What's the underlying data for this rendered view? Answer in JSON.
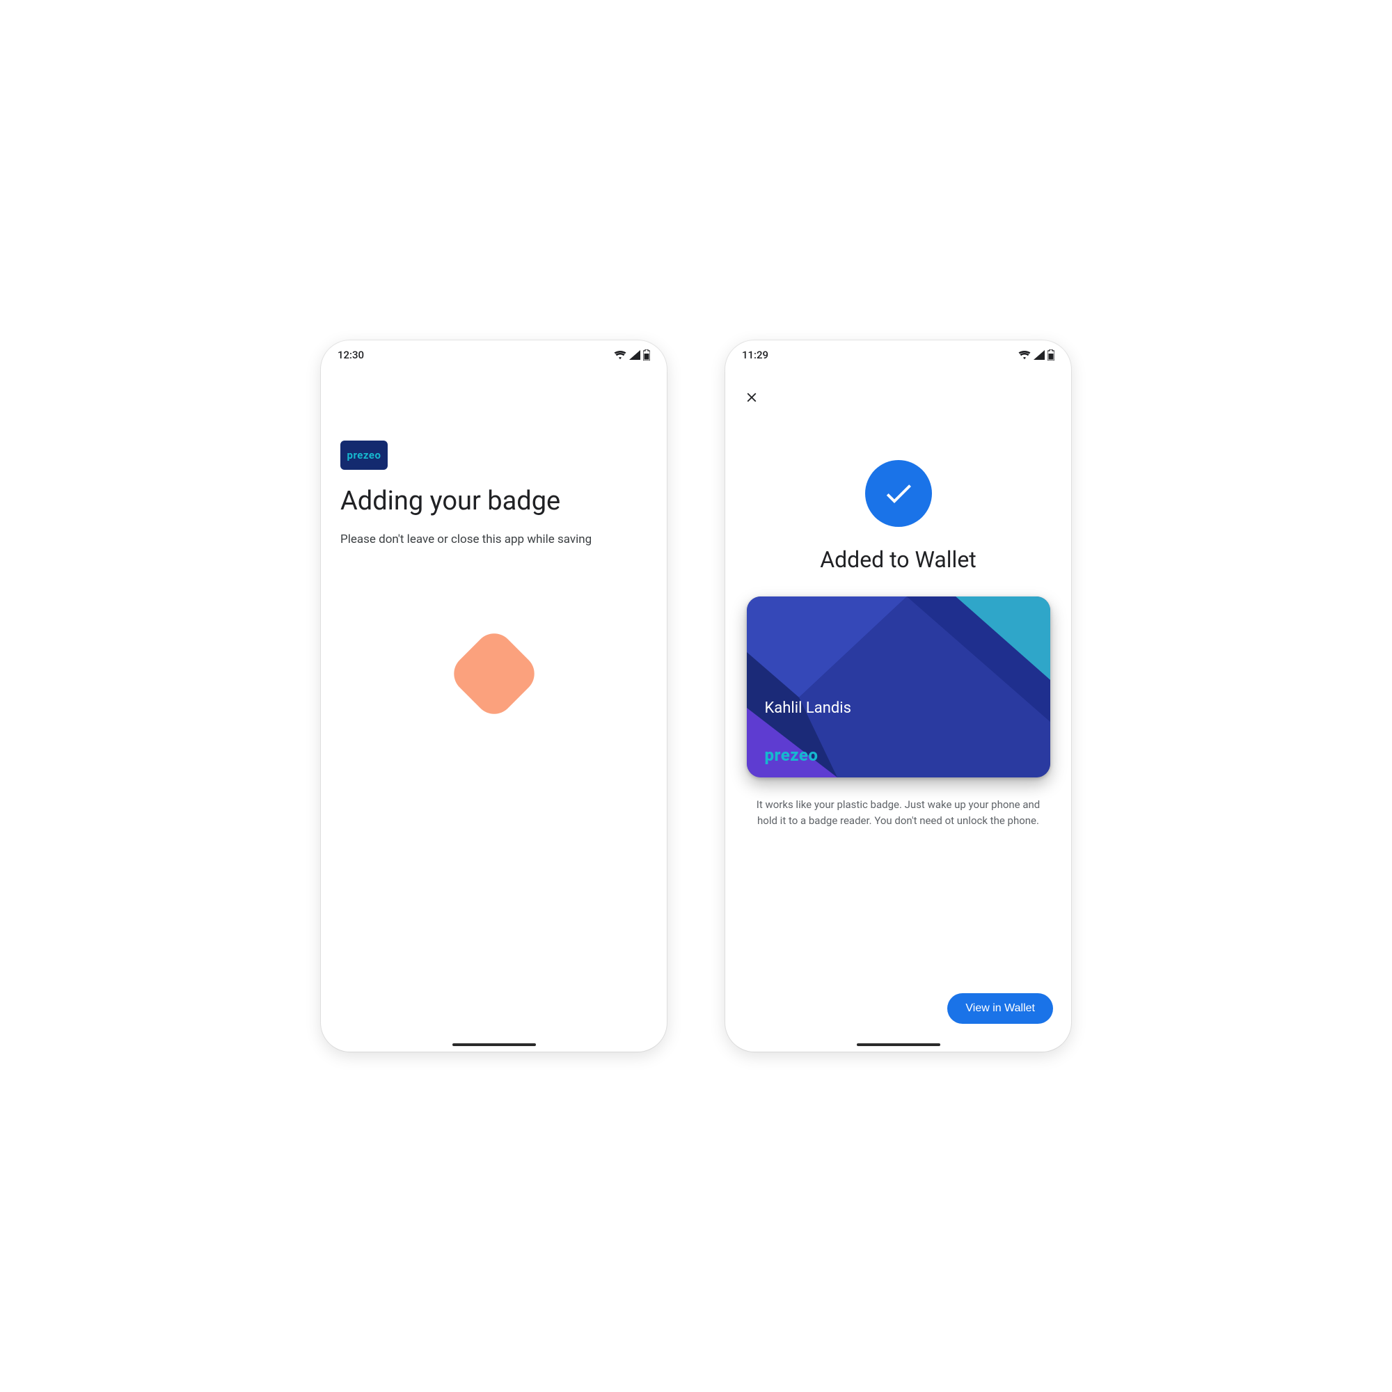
{
  "screen1": {
    "status_time": "12:30",
    "brand": "prezeo",
    "title": "Adding your badge",
    "subtitle": "Please don't leave or close this app while saving"
  },
  "screen2": {
    "status_time": "11:29",
    "close_icon": "close-icon",
    "check_icon": "check-icon",
    "title": "Added to Wallet",
    "card": {
      "holder_name": "Kahlil Landis",
      "brand": "prezeo"
    },
    "description": "It works like your plastic badge. Just wake up your phone and hold it to a badge reader. You don't need ot unlock the phone.",
    "cta_label": "View in Wallet"
  },
  "colors": {
    "accent": "#1a73e8",
    "brand_dark": "#142a6f",
    "brand_cyan": "#16b8cf",
    "peach": "#fba17d"
  }
}
